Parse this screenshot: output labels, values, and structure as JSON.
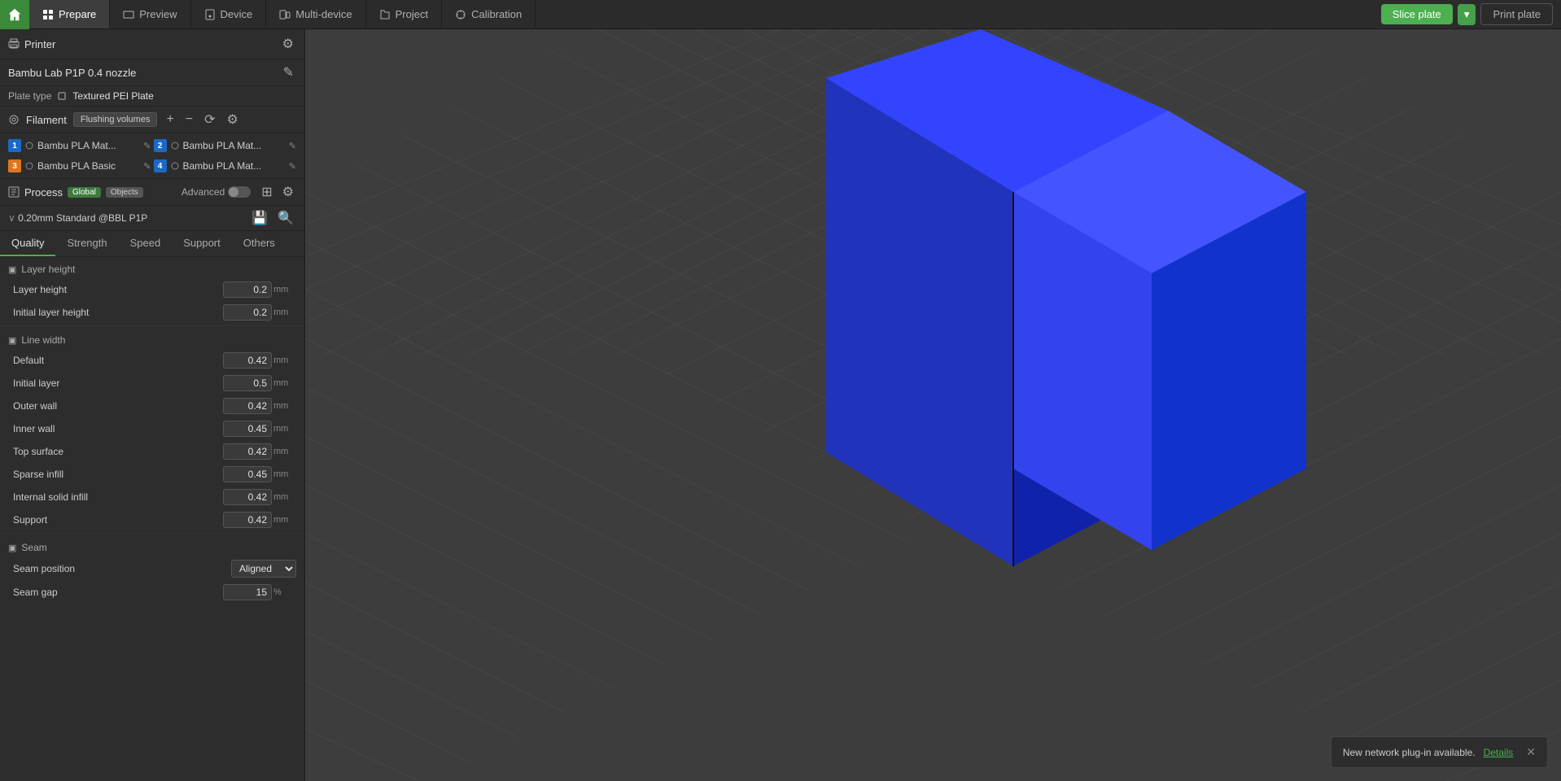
{
  "topbar": {
    "home_icon": "🏠",
    "tabs": [
      {
        "id": "prepare",
        "label": "Prepare",
        "active": true,
        "icon": "prepare"
      },
      {
        "id": "preview",
        "label": "Preview",
        "active": false,
        "icon": "preview"
      },
      {
        "id": "device",
        "label": "Device",
        "active": false,
        "icon": "device"
      },
      {
        "id": "multi-device",
        "label": "Multi-device",
        "active": false,
        "icon": "multi"
      },
      {
        "id": "project",
        "label": "Project",
        "active": false,
        "icon": "project"
      },
      {
        "id": "calibration",
        "label": "Calibration",
        "active": false,
        "icon": "calibration"
      }
    ],
    "slice_plate_label": "Slice plate",
    "print_plate_label": "Print plate"
  },
  "left_panel": {
    "printer_section": {
      "title": "Printer",
      "printer_name": "Bambu Lab P1P 0.4 nozzle",
      "plate_type_label": "Plate type",
      "plate_type_value": "Textured PEI Plate"
    },
    "filament_section": {
      "title": "Filament",
      "flushing_btn": "Flushing volumes",
      "items": [
        {
          "id": 1,
          "color": "#1a6ac5",
          "name": "Bambu PLA Mat...",
          "has_edit": true
        },
        {
          "id": 2,
          "color": "#1a6ac5",
          "name": "Bambu PLA Mat...",
          "has_edit": true
        },
        {
          "id": 3,
          "color": "#e0751a",
          "name": "Bambu PLA Basic",
          "has_edit": true
        },
        {
          "id": 4,
          "color": "#1a6ac5",
          "name": "Bambu PLA Mat...",
          "has_edit": true
        }
      ]
    },
    "process_section": {
      "title": "Process",
      "badge_global": "Global",
      "badge_objects": "Objects",
      "advanced_label": "Advanced",
      "profile_name": "0.20mm Standard @BBL P1P"
    },
    "quality_tabs": [
      {
        "id": "quality",
        "label": "Quality",
        "active": true
      },
      {
        "id": "strength",
        "label": "Strength",
        "active": false
      },
      {
        "id": "speed",
        "label": "Speed",
        "active": false
      },
      {
        "id": "support",
        "label": "Support",
        "active": false
      },
      {
        "id": "others",
        "label": "Others",
        "active": false
      }
    ],
    "settings": {
      "layer_height_group": "Layer height",
      "layer_height_label": "Layer height",
      "layer_height_value": "0.2",
      "layer_height_unit": "mm",
      "initial_layer_height_label": "Initial layer height",
      "initial_layer_height_value": "0.2",
      "initial_layer_height_unit": "mm",
      "line_width_group": "Line width",
      "default_label": "Default",
      "default_value": "0.42",
      "default_unit": "mm",
      "initial_layer_label": "Initial layer",
      "initial_layer_value": "0.5",
      "initial_layer_unit": "mm",
      "outer_wall_label": "Outer wall",
      "outer_wall_value": "0.42",
      "outer_wall_unit": "mm",
      "inner_wall_label": "Inner wall",
      "inner_wall_value": "0.45",
      "inner_wall_unit": "mm",
      "top_surface_label": "Top surface",
      "top_surface_value": "0.42",
      "top_surface_unit": "mm",
      "sparse_infill_label": "Sparse infill",
      "sparse_infill_value": "0.45",
      "sparse_infill_unit": "mm",
      "internal_solid_infill_label": "Internal solid infill",
      "internal_solid_infill_value": "0.42",
      "internal_solid_infill_unit": "mm",
      "support_label": "Support",
      "support_value": "0.42",
      "support_unit": "mm",
      "seam_group": "Seam",
      "seam_position_label": "Seam position",
      "seam_position_value": "Aligned",
      "seam_gap_label": "Seam gap",
      "seam_gap_value": "15",
      "seam_gap_unit": "%"
    }
  },
  "notification": {
    "text": "New network plug-in available.",
    "link_text": "Details"
  },
  "toolbar": {
    "buttons": [
      "cube-icon",
      "grid-icon",
      "orbit-icon",
      "frame-icon",
      "sep",
      "move-icon",
      "scale-icon",
      "rotate-icon",
      "sep2",
      "align-icon",
      "distribute-icon",
      "sep3",
      "view-icon",
      "sep4",
      "screenshot-icon"
    ]
  }
}
